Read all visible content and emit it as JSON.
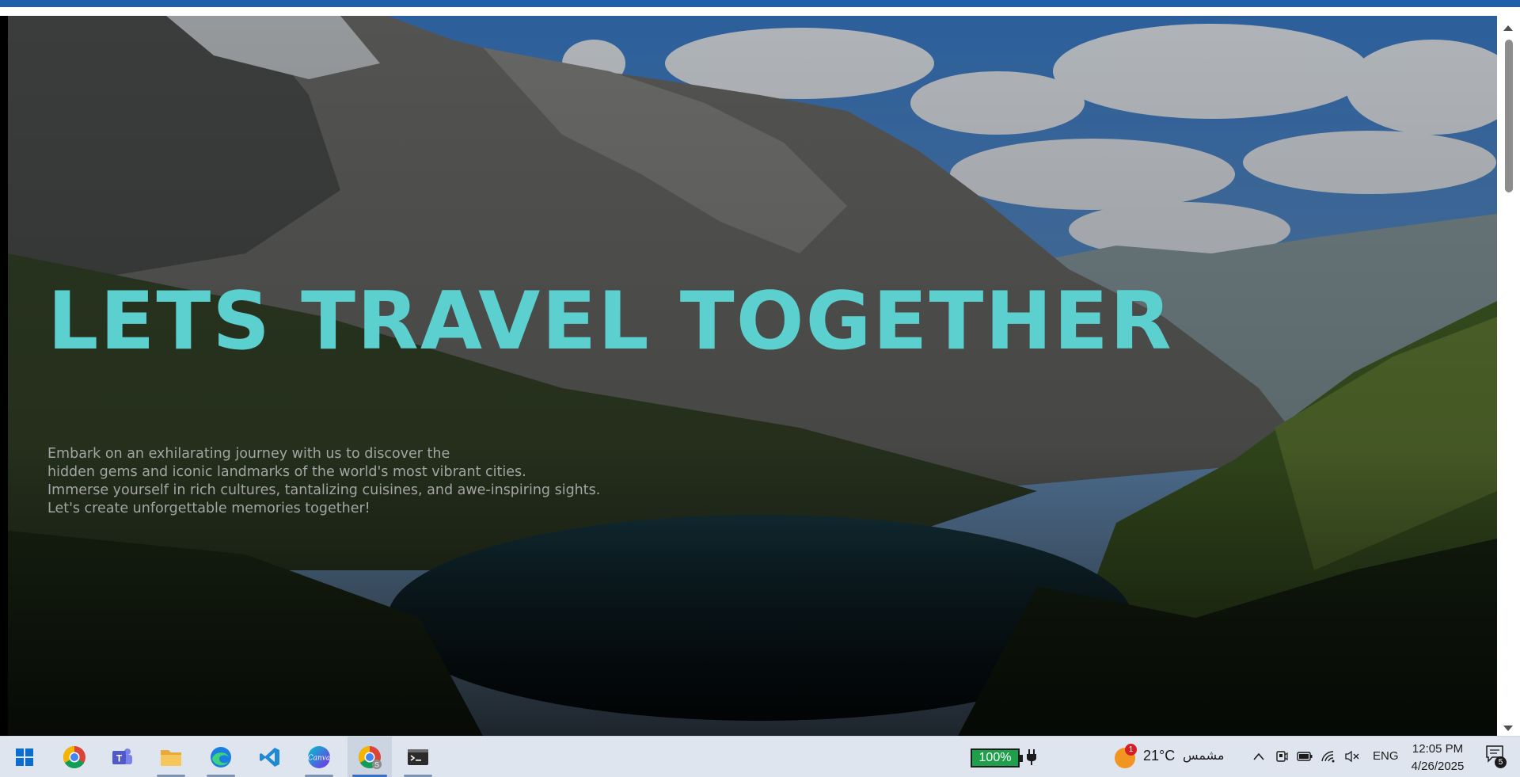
{
  "hero": {
    "title": "LETS TRAVEL TOGETHER",
    "description_lines": [
      "Embark on an exhilarating journey with us to discover the",
      "hidden gems and iconic landmarks of the world's most vibrant cities.",
      "Immerse yourself in rich cultures, tantalizing cuisines, and awe-inspiring sights.",
      "Let's create unforgettable memories together!"
    ],
    "title_color": "#5ccfcf"
  },
  "taskbar": {
    "apps": [
      {
        "name": "start-icon",
        "active": false
      },
      {
        "name": "chrome-icon",
        "active": false
      },
      {
        "name": "teams-icon",
        "active": false
      },
      {
        "name": "file-explorer-icon",
        "active": false
      },
      {
        "name": "edge-icon",
        "active": false
      },
      {
        "name": "vscode-icon",
        "active": false
      },
      {
        "name": "canva-icon",
        "active": false
      },
      {
        "name": "chrome-profile-icon",
        "active": true
      },
      {
        "name": "terminal-icon",
        "active": false
      }
    ],
    "battery": "100%",
    "weather": {
      "badge": "1",
      "temp": "21°C",
      "condition": "مشمس"
    },
    "language": "ENG",
    "clock": {
      "time": "12:05 PM",
      "date": "4/26/2025"
    },
    "notification_count": "5"
  }
}
